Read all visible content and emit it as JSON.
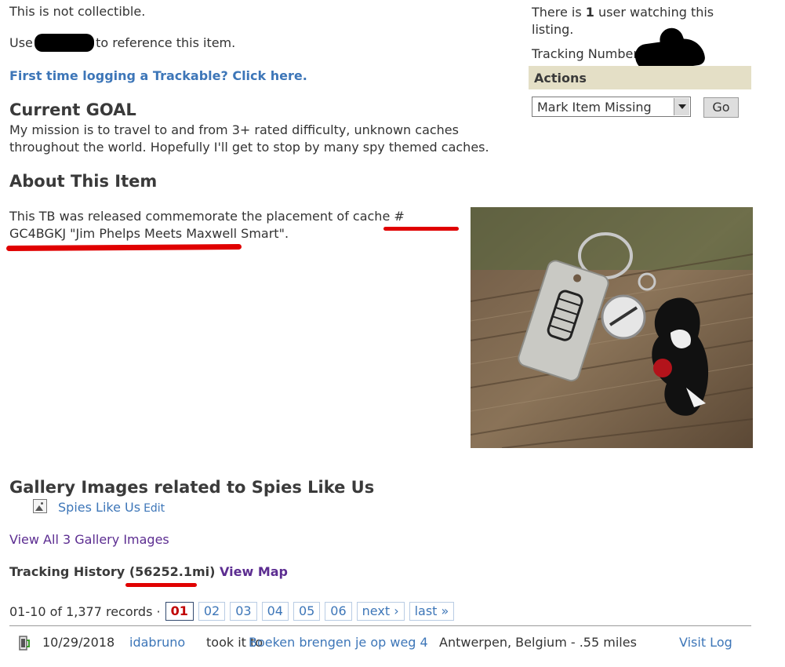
{
  "item": {
    "collectible_text": "This is not collectible.",
    "use_prefix": "Use",
    "use_suffix": "to reference this item.",
    "first_time_link": "First time logging a Trackable? Click here."
  },
  "goal": {
    "heading": "Current GOAL",
    "text": "My mission is to travel to and from 3+ rated difficulty, unknown caches throughout the world. Hopefully I'll get to stop by many spy themed caches."
  },
  "about": {
    "heading": "About This Item",
    "text_prefix": "This TB was released commemorate the placement of cache",
    "cache_code": "# GC4BGKJ",
    "cache_name": "\"Jim Phelps Meets Maxwell Smart\"."
  },
  "watchers": {
    "prefix": "There is",
    "count": "1",
    "suffix": "user watching this listing."
  },
  "tracking_number_label": "Tracking Number",
  "actions": {
    "title": "Actions",
    "selected_option": "Mark Item Missing",
    "go_label": "Go"
  },
  "gallery": {
    "heading": "Gallery Images related to Spies Like Us",
    "item_label": "Spies Like Us",
    "edit_label": "Edit",
    "view_all": "View All 3 Gallery Images"
  },
  "tracking_history": {
    "label": "Tracking History",
    "distance": "(56252.1mi)",
    "view_map": "View Map"
  },
  "pagination": {
    "summary": "01-10 of 1,377 records ·",
    "pages": [
      "01",
      "02",
      "03",
      "04",
      "05",
      "06"
    ],
    "current_page": "01",
    "next_label": "next ›",
    "last_label": "last »"
  },
  "log": {
    "date": "10/29/2018",
    "user": "idabruno",
    "action": "took it to",
    "cache": "Boeken brengen je op weg 4",
    "location": "Antwerpen, Belgium - .55 miles",
    "visit_link": "Visit Log"
  },
  "colors": {
    "link": "#3d76b8",
    "visited_link": "#5c2d91",
    "actions_bar": "#e4dfc6",
    "current_page": "#c00000",
    "annotation_red": "#e00000"
  }
}
